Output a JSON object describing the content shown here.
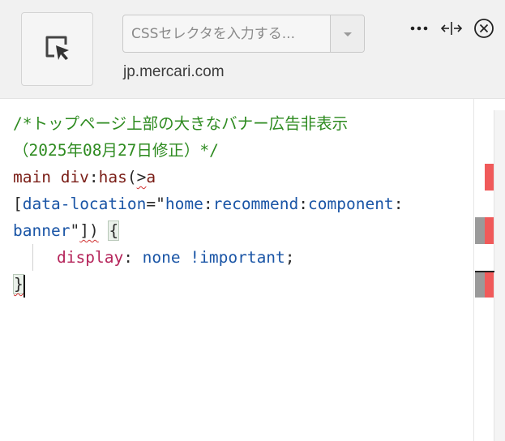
{
  "header": {
    "picker_icon": "element-picker-icon",
    "selector_placeholder": "CSSセレクタを入力する...",
    "domain": "jp.mercari.com",
    "icons": [
      "more-icon",
      "split-arrows-icon",
      "close-icon"
    ]
  },
  "editor": {
    "line1": "/*トップページ上部の大きなバナー広告非表示",
    "line2": "（2025年08月27日修正）*/",
    "line3_tag": "main div",
    "line3_colon": ":",
    "line3_pseudo": "has",
    "line3_paren": "(",
    "line3_gt": ">",
    "line3_a": "a",
    "line4_open": "[",
    "line4_attr": "data-location",
    "line4_eq": "=",
    "line4_q": "\"",
    "line4_v1": "home",
    "line4_c1": ":",
    "line4_v2": "recommend",
    "line4_c2": ":",
    "line4_v3": "component",
    "line4_c3": ":",
    "line5_v4": "banner",
    "line5_q": "\"",
    "line5_close": "])",
    "line5_space": " ",
    "line5_brace": "{",
    "line6_prop": "display",
    "line6_colon": ":",
    "line6_value": " none ",
    "line6_important": "!important",
    "line6_semi": ";",
    "line7_brace": "}"
  },
  "colors": {
    "comment": "#2e8b20",
    "selector_tag": "#7a1d16",
    "attribute": "#1a55a6",
    "property": "#b5245a",
    "error_mark": "#f05a5a"
  }
}
